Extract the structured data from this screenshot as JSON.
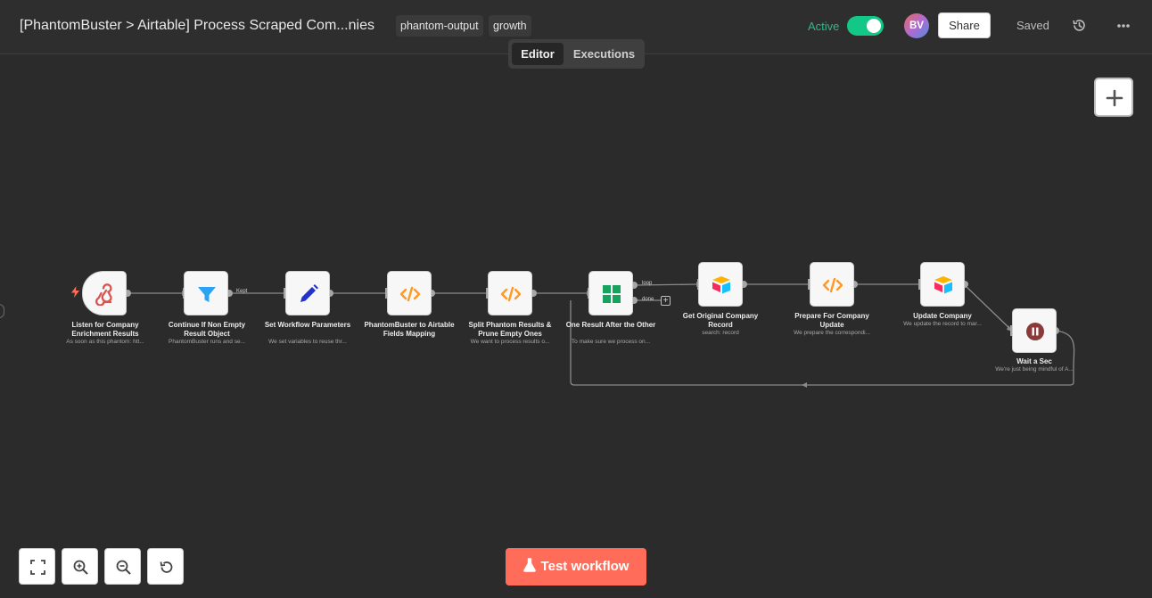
{
  "header": {
    "title": "[PhantomBuster > Airtable] Process Scraped Com...nies",
    "tags": [
      "phantom-output",
      "growth"
    ],
    "active_label": "Active",
    "avatar_initials": "BV",
    "share_label": "Share",
    "saved_label": "Saved"
  },
  "tabs": {
    "editor": "Editor",
    "executions": "Executions"
  },
  "nodes": [
    {
      "title": "Listen for Company Enrichment Results",
      "subtitle": "As soon as this phantom: htt...",
      "icon": "webhook-icon"
    },
    {
      "title": "Continue If Non Empty Result Object",
      "subtitle": "PhantomBuster runs and se...",
      "icon": "filter-icon"
    },
    {
      "title": "Set Workflow Parameters",
      "subtitle": "We set variables to reuse thr...",
      "icon": "pencil-icon"
    },
    {
      "title": "PhantomBuster to Airtable Fields Mapping",
      "subtitle": "",
      "icon": "code-icon"
    },
    {
      "title": "Split Phantom Results & Prune Empty Ones",
      "subtitle": "We want to process results o...",
      "icon": "code-icon"
    },
    {
      "title": "One Result After the Other",
      "subtitle": "To make sure we process on...",
      "icon": "grid-icon"
    },
    {
      "title": "Get Original Company Record",
      "subtitle": "search: record",
      "icon": "airtable-icon"
    },
    {
      "title": "Prepare For Company Update",
      "subtitle": "We prepare the correspondi...",
      "icon": "code-icon"
    },
    {
      "title": "Update Company",
      "subtitle": "We update the record to mar...",
      "icon": "airtable-icon"
    },
    {
      "title": "Wait a Sec",
      "subtitle": "We're just being mindful of A...",
      "icon": "pause-icon"
    }
  ],
  "edge_labels": {
    "kept": "Kept",
    "loop": "loop",
    "done": "done"
  },
  "test_button": "Test workflow",
  "colors": {
    "accent": "#ff6d5a",
    "active_green": "#13c786",
    "code_orange": "#ff9922",
    "filter_blue": "#2aa3f4",
    "set_blue": "#2333c7",
    "split_green": "#17a25e",
    "wait_red": "#8b3a3a"
  }
}
